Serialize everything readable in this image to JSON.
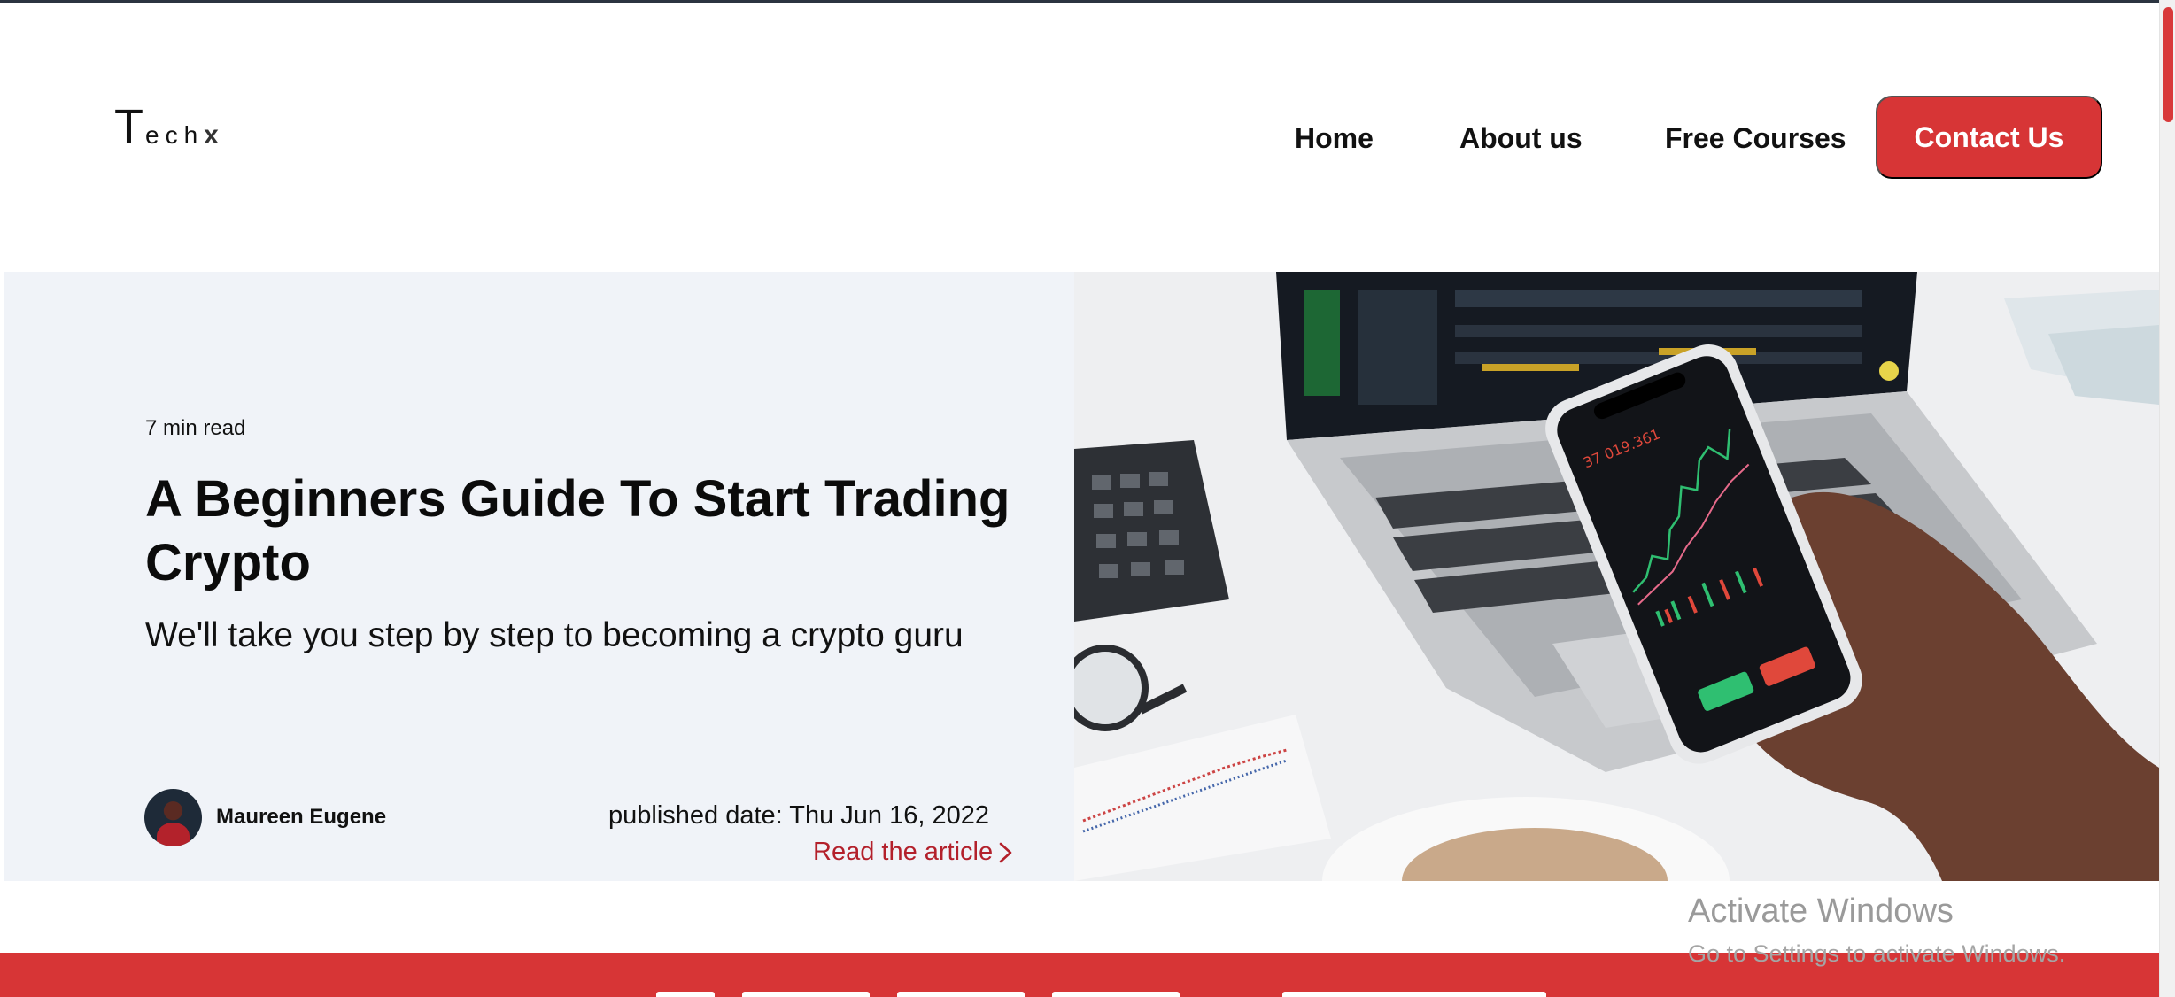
{
  "header": {
    "logo": {
      "first": "T",
      "rest": "ech",
      "last": "x"
    },
    "nav": [
      {
        "label": "Home"
      },
      {
        "label": "About us"
      },
      {
        "label": "Free Courses"
      }
    ],
    "cta_label": "Contact Us"
  },
  "hero": {
    "read_time": "7 min read",
    "title": "A Beginners Guide To Start Trading Crypto",
    "subtitle": "We'll take you step by step to becoming a crypto guru",
    "author": "Maureen Eugene",
    "published": "published date: Thu Jun 16, 2022",
    "read_link": "Read the article",
    "image_alt": "hand-holding-phone-with-crypto-chart"
  },
  "watermark": {
    "title": "Activate Windows",
    "subtitle": "Go to Settings to activate Windows."
  },
  "colors": {
    "accent": "#d73536",
    "hero_bg": "#f0f3f8",
    "link": "#b3202b"
  }
}
